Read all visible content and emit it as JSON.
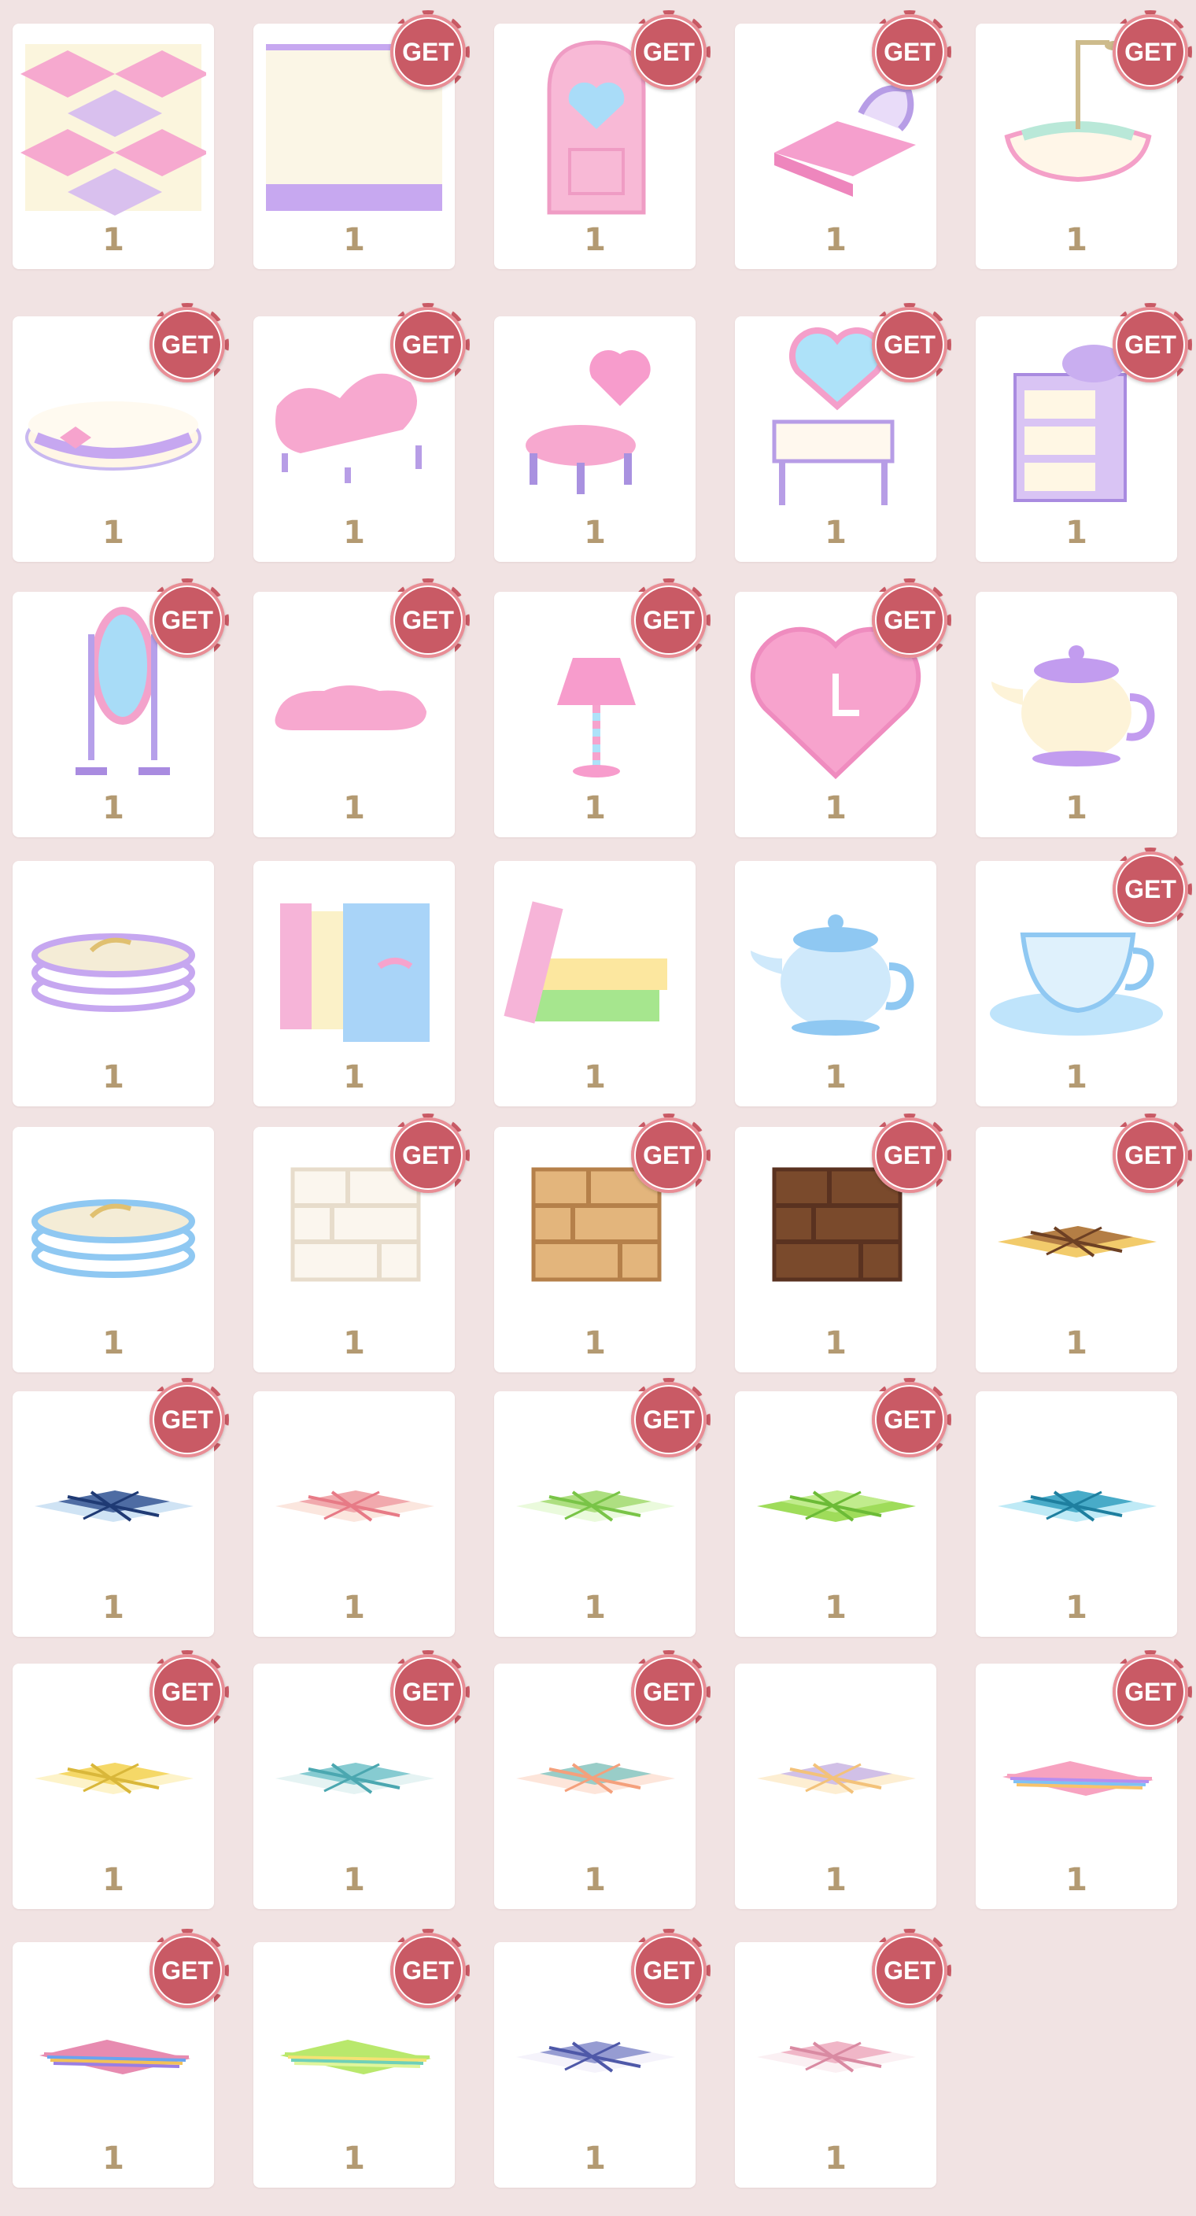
{
  "colors": {
    "background": "#f1e3e3",
    "card": "#ffffff",
    "badge": "#c95a65",
    "count_text": "#b39a72"
  },
  "badge_label": "GET",
  "items": [
    {
      "name": "harlequin-wallpaper-icon",
      "count": "1",
      "get": false
    },
    {
      "name": "cream-lilac-wallpaper-icon",
      "count": "1",
      "get": true
    },
    {
      "name": "heart-door-icon",
      "count": "1",
      "get": true
    },
    {
      "name": "pink-bed-icon",
      "count": "1",
      "get": true
    },
    {
      "name": "bathtub-icon",
      "count": "1",
      "get": true
    },
    {
      "name": "round-ottoman-icon",
      "count": "1",
      "get": true
    },
    {
      "name": "pink-chaise-sofa-icon",
      "count": "1",
      "get": true
    },
    {
      "name": "heart-chair-icon",
      "count": "1",
      "get": false
    },
    {
      "name": "heart-vanity-icon",
      "count": "1",
      "get": true
    },
    {
      "name": "lilac-dresser-icon",
      "count": "1",
      "get": true
    },
    {
      "name": "standing-mirror-icon",
      "count": "1",
      "get": true
    },
    {
      "name": "pink-cloud-rug-icon",
      "count": "1",
      "get": true
    },
    {
      "name": "floor-lamp-icon",
      "count": "1",
      "get": true
    },
    {
      "name": "heart-clock-icon",
      "count": "1",
      "get": true
    },
    {
      "name": "lilac-teapot-icon",
      "count": "1",
      "get": false
    },
    {
      "name": "lilac-plate-stack-icon",
      "count": "1",
      "get": false
    },
    {
      "name": "pastel-books-icon",
      "count": "1",
      "get": false
    },
    {
      "name": "stacked-books-icon",
      "count": "1",
      "get": false
    },
    {
      "name": "blue-teapot-icon",
      "count": "1",
      "get": false
    },
    {
      "name": "blue-teacup-icon",
      "count": "1",
      "get": true
    },
    {
      "name": "blue-plate-stack-icon",
      "count": "1",
      "get": false
    },
    {
      "name": "white-shelf-icon",
      "count": "1",
      "get": true
    },
    {
      "name": "oak-shelf-icon",
      "count": "1",
      "get": true
    },
    {
      "name": "walnut-shelf-icon",
      "count": "1",
      "get": true
    },
    {
      "name": "brown-plaid-rug-icon",
      "count": "1",
      "get": true
    },
    {
      "name": "navy-plaid-rug-icon",
      "count": "1",
      "get": true
    },
    {
      "name": "coral-pattern-rug-icon",
      "count": "1",
      "get": false
    },
    {
      "name": "green-pattern-rug-icon",
      "count": "1",
      "get": true
    },
    {
      "name": "green-check-rug-icon",
      "count": "1",
      "get": true
    },
    {
      "name": "teal-check-rug-icon",
      "count": "1",
      "get": false
    },
    {
      "name": "yellow-tile-rug-icon",
      "count": "1",
      "get": true
    },
    {
      "name": "teal-tile-rug-icon",
      "count": "1",
      "get": true
    },
    {
      "name": "teal-plaid-rug-icon",
      "count": "1",
      "get": true
    },
    {
      "name": "cream-plaid-rug-icon",
      "count": "1",
      "get": false
    },
    {
      "name": "rainbow-stripe-rug-icon",
      "count": "1",
      "get": true
    },
    {
      "name": "multi-stripe-rug-icon",
      "count": "1",
      "get": true
    },
    {
      "name": "lime-stripe-rug-icon",
      "count": "1",
      "get": true
    },
    {
      "name": "navy-lattice-rug-icon",
      "count": "1",
      "get": true
    },
    {
      "name": "pink-lattice-rug-icon",
      "count": "1",
      "get": true
    }
  ]
}
